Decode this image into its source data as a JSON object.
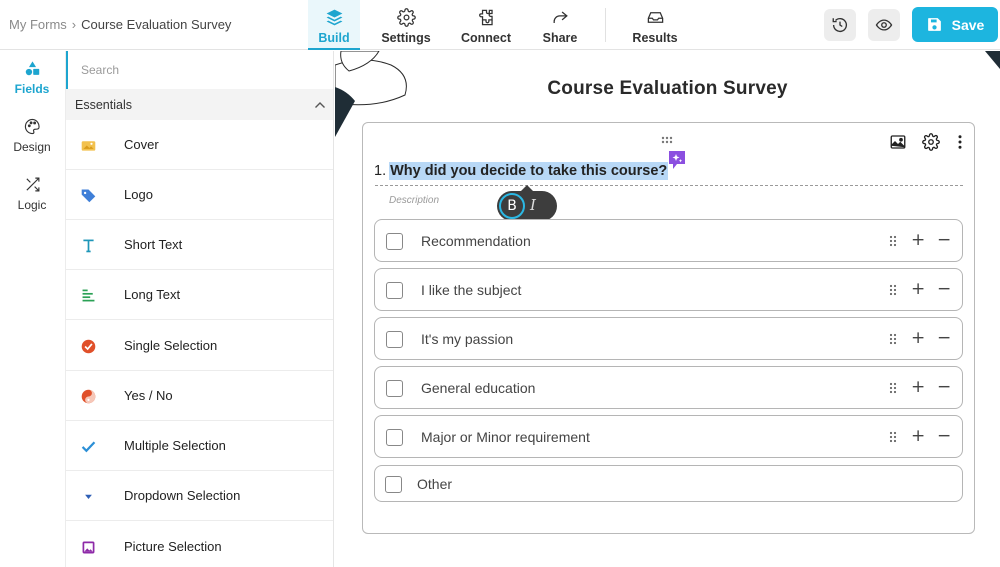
{
  "breadcrumb": {
    "root": "My Forms",
    "separator": "›",
    "current": "Course Evaluation Survey"
  },
  "nav": {
    "build": "Build",
    "settings": "Settings",
    "connect": "Connect",
    "share": "Share",
    "results": "Results"
  },
  "actions": {
    "save": "Save"
  },
  "rail": {
    "fields": "Fields",
    "design": "Design",
    "logic": "Logic"
  },
  "panel": {
    "search_placeholder": "Search",
    "section": "Essentials",
    "items": [
      {
        "label": "Cover",
        "icon": "cover-icon"
      },
      {
        "label": "Logo",
        "icon": "logo-tag-icon"
      },
      {
        "label": "Short Text",
        "icon": "short-text-icon"
      },
      {
        "label": "Long Text",
        "icon": "long-text-icon"
      },
      {
        "label": "Single Selection",
        "icon": "single-selection-icon"
      },
      {
        "label": "Yes / No",
        "icon": "yes-no-icon"
      },
      {
        "label": "Multiple Selection",
        "icon": "checkmark-icon"
      },
      {
        "label": "Dropdown Selection",
        "icon": "dropdown-icon"
      },
      {
        "label": "Picture Selection",
        "icon": "picture-icon"
      }
    ]
  },
  "form": {
    "title": "Course Evaluation Survey",
    "question_number": "1.",
    "question": "Why did you decide to take this course?",
    "description_placeholder": "Description",
    "format": {
      "bold": "B",
      "italic": "I"
    },
    "options": [
      "Recommendation",
      "I like the subject",
      "It's my passion",
      "General education",
      "Major or Minor requirement"
    ],
    "other_option": "Other",
    "option_add": "+",
    "option_remove": "−"
  },
  "colors": {
    "accent": "#1da5cf",
    "save_button": "#1db5df",
    "highlight": "#b8d8f6",
    "ai_badge": "#8b4fe0"
  }
}
